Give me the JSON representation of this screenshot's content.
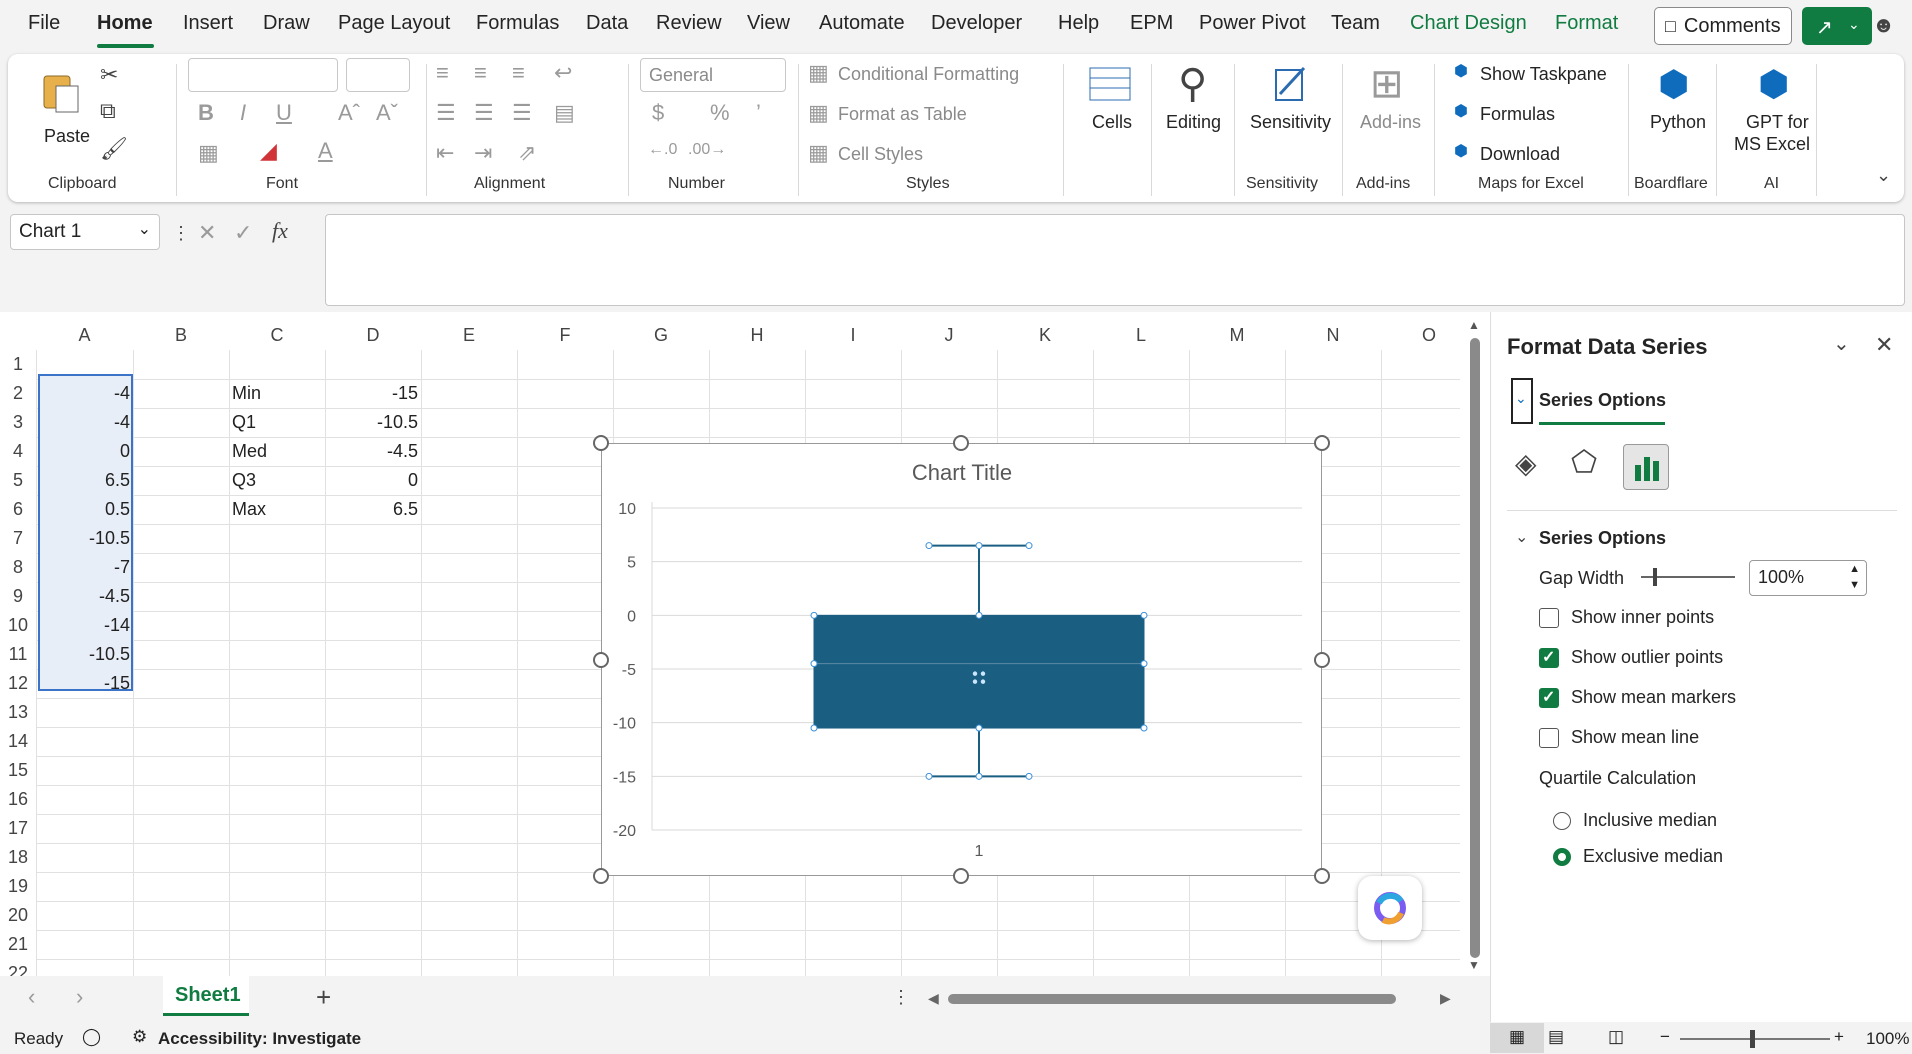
{
  "menu": {
    "items": [
      "File",
      "Home",
      "Insert",
      "Draw",
      "Page Layout",
      "Formulas",
      "Data",
      "Review",
      "View",
      "Automate",
      "Developer",
      "Help",
      "EPM",
      "Power Pivot",
      "Team",
      "Chart Design",
      "Format"
    ],
    "active": "Home",
    "comments_label": "Comments"
  },
  "ribbon": {
    "clipboard": {
      "paste": "Paste",
      "label": "Clipboard"
    },
    "font": {
      "label": "Font"
    },
    "alignment": {
      "label": "Alignment"
    },
    "number": {
      "format": "General",
      "label": "Number"
    },
    "styles": {
      "conditional": "Conditional Formatting",
      "table": "Format as Table",
      "cell": "Cell Styles",
      "label": "Styles"
    },
    "cells": {
      "label": "Cells"
    },
    "editing": {
      "label": "Editing"
    },
    "sensitivity": {
      "button": "Sensitivity",
      "label": "Sensitivity"
    },
    "addins": {
      "button": "Add-ins",
      "label": "Add-ins"
    },
    "maps": {
      "taskpane": "Show Taskpane",
      "formulas": "Formulas",
      "download": "Download",
      "label": "Maps for Excel"
    },
    "boardflare": {
      "button": "Python",
      "label": "Boardflare"
    },
    "ai": {
      "button_line1": "GPT for",
      "button_line2": "MS Excel",
      "label": "AI"
    }
  },
  "formula_bar": {
    "name_box": "Chart 1",
    "fx": "fx",
    "content": ""
  },
  "columns": [
    "A",
    "B",
    "C",
    "D",
    "E",
    "F",
    "G",
    "H",
    "I",
    "J",
    "K",
    "L",
    "M",
    "N",
    "O"
  ],
  "rows": [
    "1",
    "2",
    "3",
    "4",
    "5",
    "6",
    "7",
    "8",
    "9",
    "10",
    "11",
    "12",
    "13",
    "14",
    "15",
    "16",
    "17",
    "18",
    "19",
    "20",
    "21",
    "22"
  ],
  "cells": {
    "colA": [
      "-4",
      "-4",
      "0",
      "6.5",
      "0.5",
      "-10.5",
      "-7",
      "-4.5",
      "-14",
      "-10.5",
      "-15"
    ],
    "stats_labels": [
      "Min",
      "Q1",
      "Med",
      "Q3",
      "Max"
    ],
    "stats_values": [
      "-15",
      "-10.5",
      "-4.5",
      "0",
      "6.5"
    ]
  },
  "chart_data": {
    "type": "box",
    "title": "Chart Title",
    "categories": [
      "1"
    ],
    "yticks": [
      "10",
      "5",
      "0",
      "-5",
      "-10",
      "-15",
      "-20"
    ],
    "ylim": [
      -20,
      10
    ],
    "box": {
      "min": -15,
      "q1": -10.5,
      "median": -4.5,
      "q3": 0,
      "max": 6.5
    },
    "fill_color": "#1a5e82"
  },
  "sheets": {
    "active": "Sheet1"
  },
  "status": {
    "ready": "Ready",
    "accessibility": "Accessibility: Investigate",
    "zoom": "100%"
  },
  "pane": {
    "title": "Format Data Series",
    "tab": "Series Options",
    "section": "Series Options",
    "gap_width_label": "Gap Width",
    "gap_width_value": "100%",
    "checkboxes": [
      {
        "label": "Show inner points",
        "checked": false
      },
      {
        "label": "Show outlier points",
        "checked": true
      },
      {
        "label": "Show mean markers",
        "checked": true
      },
      {
        "label": "Show mean line",
        "checked": false
      }
    ],
    "quartile_label": "Quartile Calculation",
    "radios": [
      {
        "label": "Inclusive median",
        "checked": false
      },
      {
        "label": "Exclusive median",
        "checked": true
      }
    ]
  },
  "colors": {
    "accent": "#107c41",
    "selection": "#3a73c7"
  }
}
